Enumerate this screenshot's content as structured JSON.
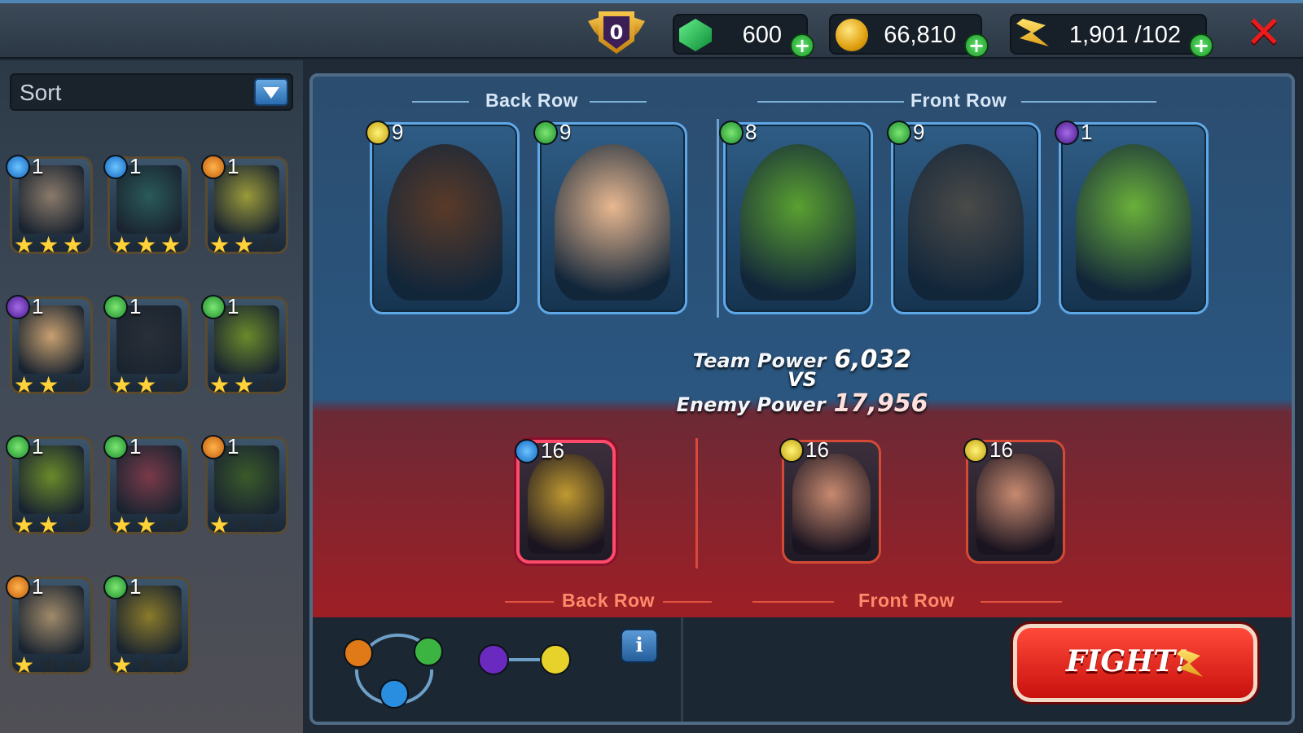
{
  "topbar": {
    "rank": "0",
    "gems": "600",
    "gold": "66,810",
    "energy": "1,901 /102",
    "plus": "+",
    "close": "✕"
  },
  "sidebar": {
    "sort_label": "Sort",
    "roster": [
      {
        "element": "water",
        "level": "1",
        "stars": 3,
        "color": "#8a7a6a"
      },
      {
        "element": "water",
        "level": "1",
        "stars": 3,
        "color": "#2a5a5a"
      },
      {
        "element": "fire",
        "level": "1",
        "stars": 2,
        "color": "#9a9a3a"
      },
      {
        "element": "dark",
        "level": "1",
        "stars": 2,
        "color": "#c8a070"
      },
      {
        "element": "nature",
        "level": "1",
        "stars": 2,
        "color": "#2a2f38"
      },
      {
        "element": "nature",
        "level": "1",
        "stars": 2,
        "color": "#6a8a2a"
      },
      {
        "element": "nature",
        "level": "1",
        "stars": 2,
        "color": "#6a8a2a"
      },
      {
        "element": "nature",
        "level": "1",
        "stars": 2,
        "color": "#7a3a4a"
      },
      {
        "element": "fire",
        "level": "1",
        "stars": 1,
        "color": "#3a5a2a"
      },
      {
        "element": "fire",
        "level": "1",
        "stars": 1,
        "color": "#a08a6a"
      },
      {
        "element": "nature",
        "level": "1",
        "stars": 1,
        "color": "#8a7a2a"
      }
    ]
  },
  "team": {
    "back_row_label": "Back Row",
    "front_row_label": "Front Row",
    "heroes": [
      {
        "element": "light",
        "level": "9",
        "color": "#5a3a28"
      },
      {
        "element": "nature",
        "level": "9",
        "color": "#e8b890"
      },
      {
        "element": "nature",
        "level": "8",
        "color": "#5aa030"
      },
      {
        "element": "nature",
        "level": "9",
        "color": "#4a4a48"
      },
      {
        "element": "dark",
        "level": "1",
        "color": "#6ab03a"
      }
    ]
  },
  "power": {
    "team_label": "Team Power",
    "team_value": "6,032",
    "vs": "VS",
    "enemy_label": "Enemy Power",
    "enemy_value": "17,956"
  },
  "enemy": {
    "back_row_label": "Back Row",
    "front_row_label": "Front Row",
    "units": [
      {
        "element": "water",
        "level": "16",
        "color": "#c09a30"
      },
      {
        "element": "light",
        "level": "16",
        "color": "#c88a70"
      },
      {
        "element": "light",
        "level": "16",
        "color": "#c88a70"
      }
    ]
  },
  "footer": {
    "info": "i",
    "fight": "FIGHT!"
  }
}
